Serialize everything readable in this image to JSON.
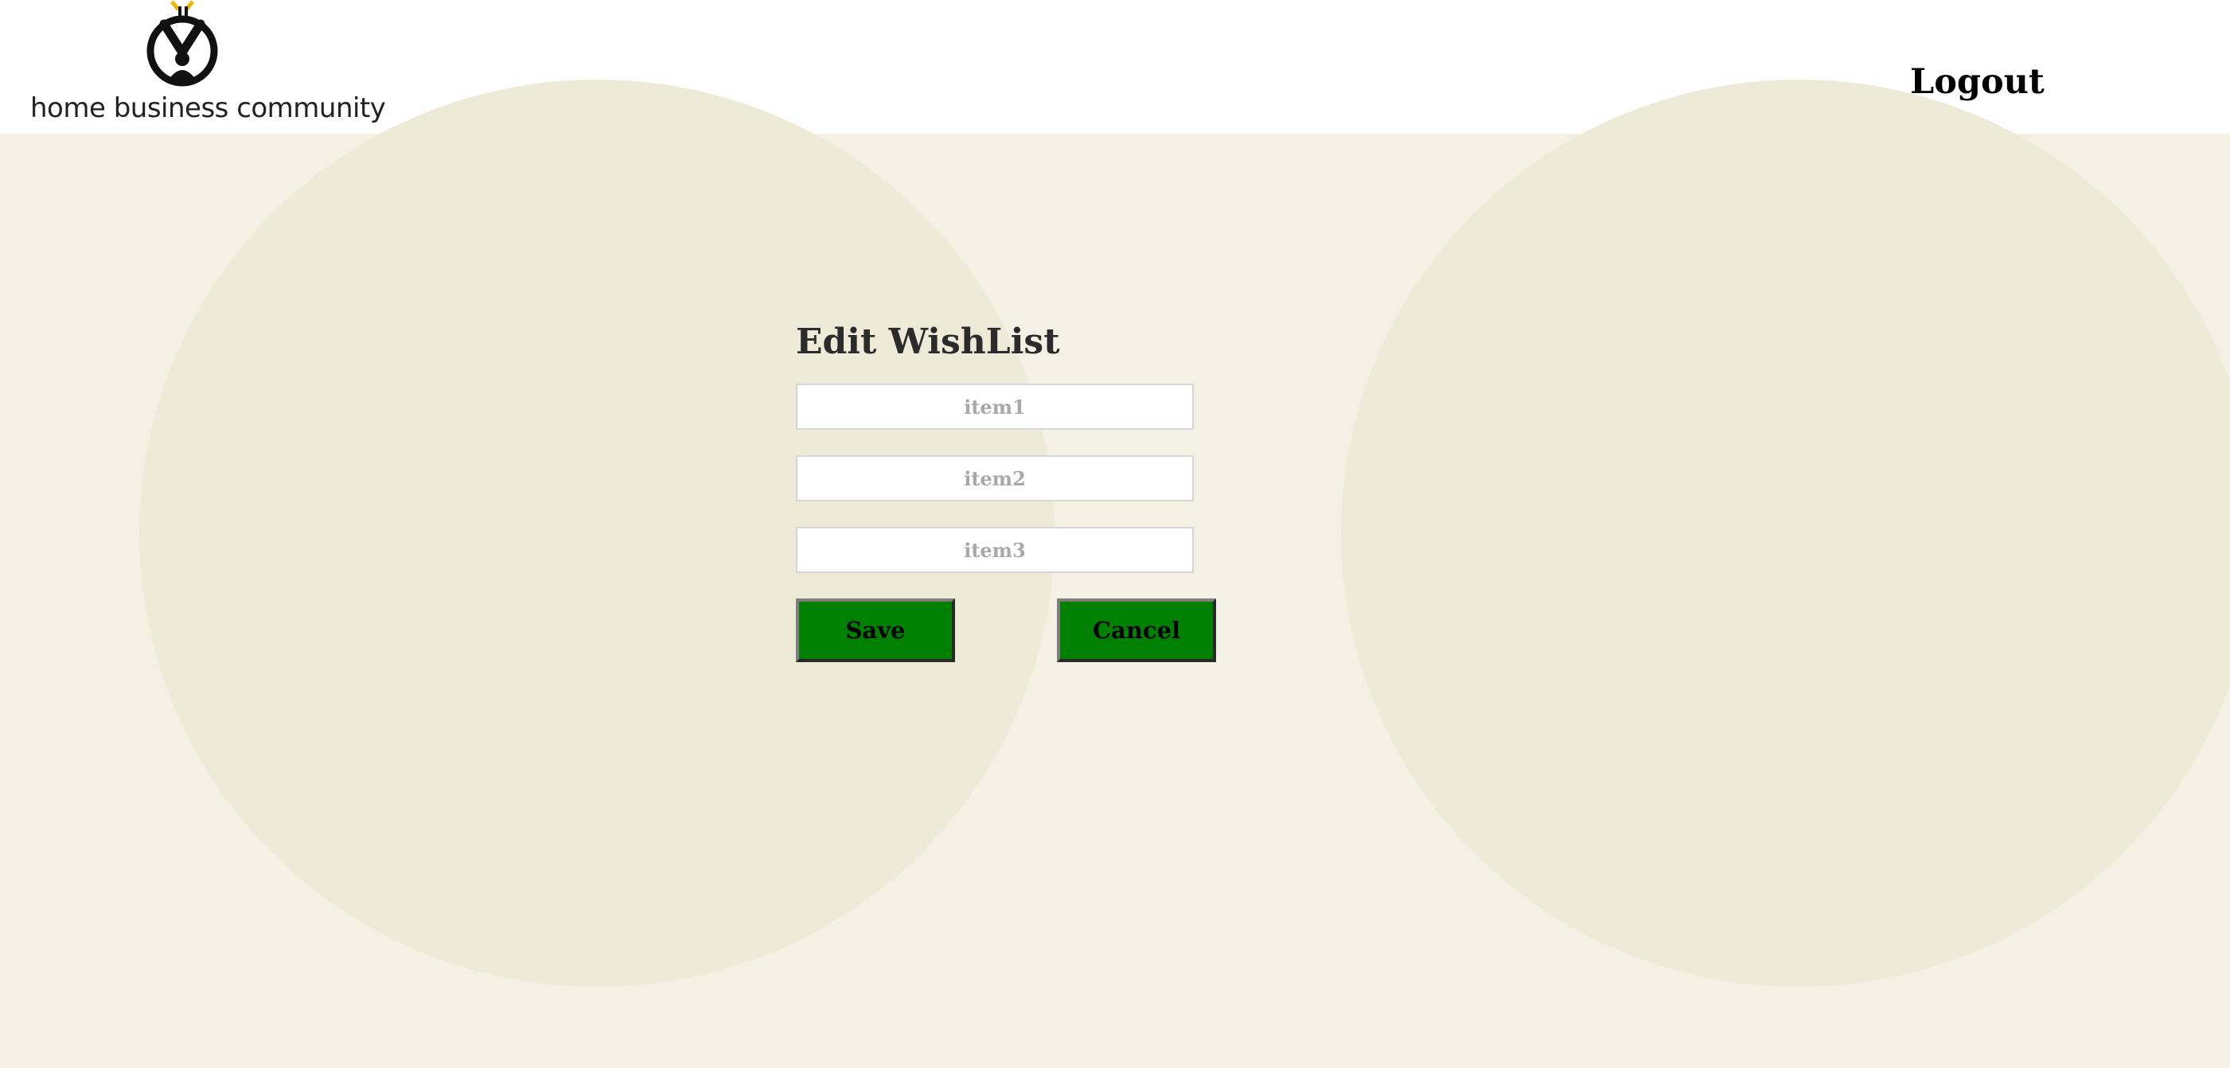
{
  "header": {
    "logo_text": "home business community",
    "logo_icon": "person-with-plug-icon",
    "logout_label": "Logout"
  },
  "form": {
    "title": "Edit WishList",
    "fields": [
      {
        "value": "",
        "placeholder": "item1"
      },
      {
        "value": "",
        "placeholder": "item2"
      },
      {
        "value": "",
        "placeholder": "item3"
      }
    ],
    "save_label": "Save",
    "cancel_label": "Cancel"
  },
  "colors": {
    "page_background": "#f3f1e4",
    "background_circles": "#edead8",
    "header_background": "#ffffff",
    "button_green": "#008000",
    "logo_accent": "#f0b400"
  }
}
